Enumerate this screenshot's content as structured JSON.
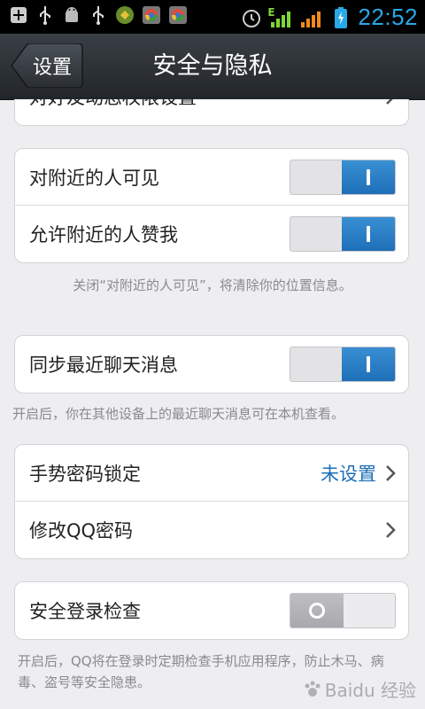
{
  "status_bar": {
    "time": "22:52",
    "network_label": "E",
    "icons_left": [
      "add-icon",
      "usb-icon",
      "android-debug-icon",
      "usb-icon",
      "app-icon",
      "chrome-icon",
      "chrome-icon"
    ],
    "icons_right": [
      "alarm-icon",
      "signal-e-icon",
      "signal-icon",
      "battery-charging-icon"
    ]
  },
  "header": {
    "back_label": "设置",
    "title": "安全与隐私"
  },
  "groups": {
    "partial_row_label": "对好友动态权限设置",
    "nearby": {
      "visible_label": "对附近的人可见",
      "visible_on": true,
      "like_label": "允许附近的人赞我",
      "like_on": true,
      "note": "关闭“对附近的人可见”，将清除你的位置信息。"
    },
    "sync": {
      "label": "同步最近聊天消息",
      "on": true,
      "note": "开启后，你在其他设备上的最近聊天消息可在本机查看。"
    },
    "password": {
      "gesture_label": "手势密码锁定",
      "gesture_value": "未设置",
      "change_label": "修改QQ密码"
    },
    "security": {
      "label": "安全登录检查",
      "on": false,
      "note": "开启后，QQ将在登录时定期检查手机应用程序，防止木马、病毒、盗号等安全隐患。"
    }
  },
  "watermark": "Baidu 经验",
  "colors": {
    "accent": "#1e6fb8",
    "time": "#28a8e8",
    "background": "#eeeef0"
  }
}
